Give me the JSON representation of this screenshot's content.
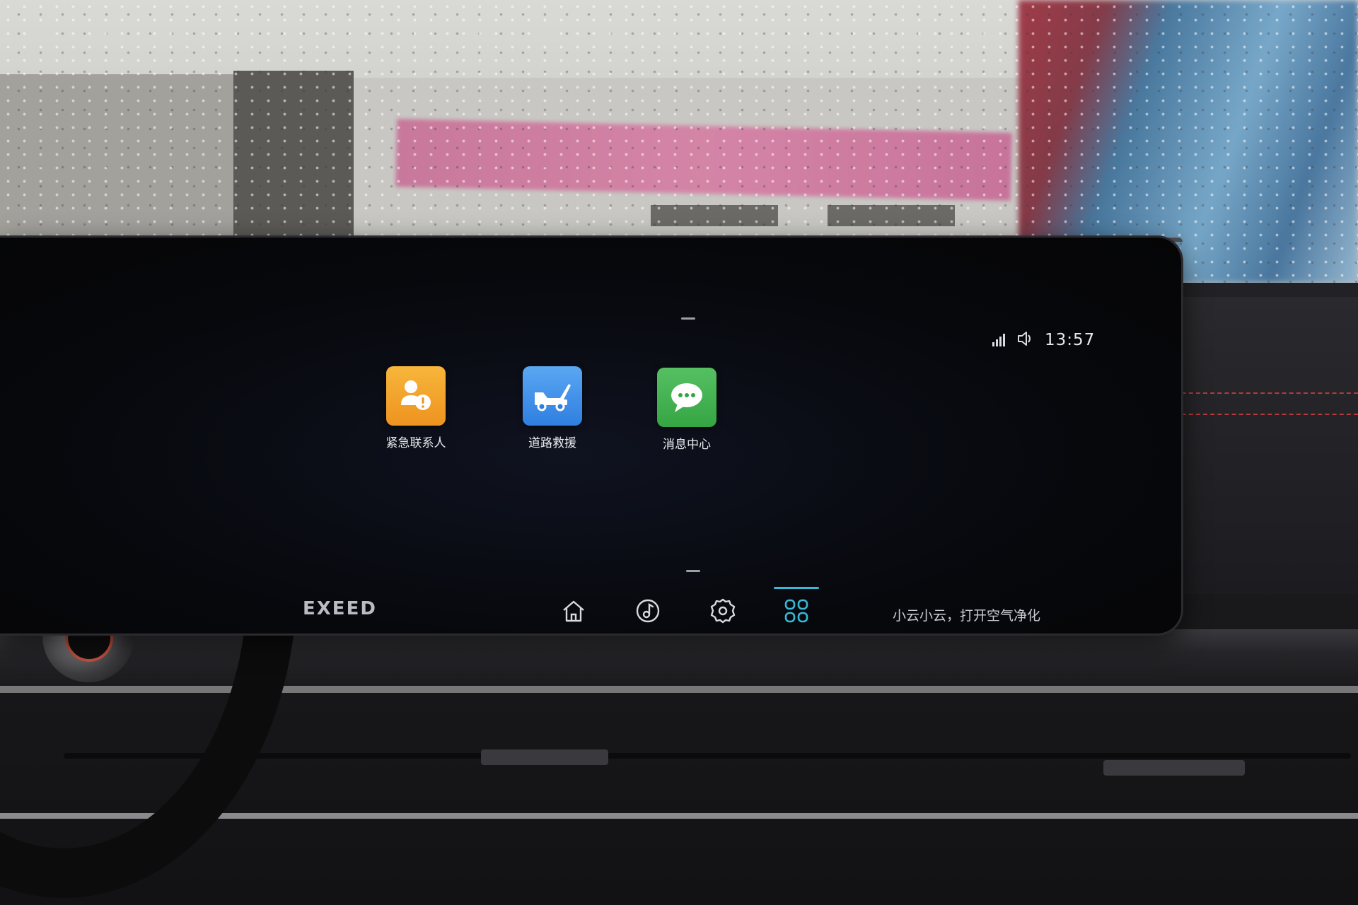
{
  "status": {
    "time": "13:57",
    "signal_icon": "signal-bars-icon",
    "volume_icon": "speaker-icon"
  },
  "apps": [
    {
      "label": "紧急联系人",
      "icon": "emergency-contact-icon",
      "color": "#f2a62a"
    },
    {
      "label": "道路救援",
      "icon": "tow-truck-icon",
      "color": "#3f8fe8"
    },
    {
      "label": "消息中心",
      "icon": "message-bubble-icon",
      "color": "#3cae4a"
    }
  ],
  "brand": {
    "logo": "EXEED"
  },
  "nav": {
    "items": [
      {
        "icon": "home-icon"
      },
      {
        "icon": "music-icon"
      },
      {
        "icon": "settings-icon"
      },
      {
        "icon": "apps-grid-icon"
      }
    ],
    "active_color": "#39b8d8"
  },
  "voice_hint": "小云小云，打开空气净化"
}
